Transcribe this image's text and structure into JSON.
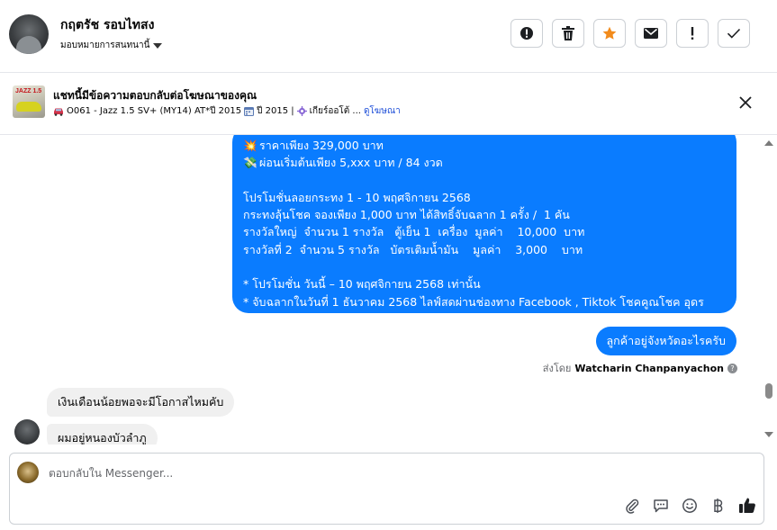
{
  "header": {
    "contact_name": "กฤตรัช รอบไทสง",
    "assign_label": "มอบหมายการสนทนานี้",
    "actions": [
      "alert-circle",
      "trash",
      "star",
      "envelope",
      "exclamation",
      "check"
    ],
    "star_color": "#f28b1c"
  },
  "banner": {
    "title": "แชทนี้มีข้อความตอบกลับต่อโฆษณาของคุณ",
    "car_text": "O061 - Jazz 1.5 SV+ (MY14) AT*ปี 2015",
    "year_text": "ปี 2015 |",
    "gear_text": "เกียร์ออโต้ ...",
    "link_text": "ดูโฆษณา",
    "thumb_text": "JAZZ 1.5"
  },
  "thread": {
    "promo_lines": [
      {
        "emoji": "💥",
        "text": "ราคาเพียง 329,000 บาท"
      },
      {
        "emoji": "💸",
        "text": "ผ่อนเริ่มต้นเพียง 5,xxx บาท / 84 งวด"
      },
      {
        "emoji": "",
        "text": ""
      },
      {
        "emoji": "",
        "text": "โปรโมชั่นลอยกระทง 1 - 10 พฤศจิกายน 2568"
      },
      {
        "emoji": "",
        "text": "กระทงลุ้นโชค จองเพียง 1,000 บาท ได้สิทธิ์จับฉลาก 1 ครั้ง /  1 คัน"
      },
      {
        "emoji": "",
        "text": "รางวัลใหญ่  จำนวน 1 รางวัล   ตู้เย็น 1  เครื่อง  มูลค่า    10,000  บาท"
      },
      {
        "emoji": "",
        "text": "รางวัลที่ 2  จำนวน 5 รางวัล   บัตรเติมน้ำมัน    มูลค่า    3,000    บาท"
      },
      {
        "emoji": "",
        "text": ""
      },
      {
        "emoji": "",
        "text": "* โปรโมชั่น วันนี้ – 10 พฤศจิกายน 2568 เท่านั้น"
      },
      {
        "emoji": "",
        "text": "* จับฉลากในวันที่ 1 ธันวาคม 2568 ไลฟ์สดผ่านช่องทาง Facebook , Tiktok โชคคูณโชค อุดร"
      }
    ],
    "reply_question": "ลูกค้าอยู่จังหวัดอะไรครับ",
    "sent_by_prefix": "ส่งโดย",
    "sent_by_name": "Watcharin Chanpanyachon",
    "customer_msg_1": "เงินเดือนน้อยพอจะมีโอกาสไหมคับ",
    "customer_msg_2": "ผมอยู่หนองบัวลำภู"
  },
  "compose": {
    "placeholder": "ตอบกลับใน Messenger...",
    "tools": [
      "paperclip",
      "chat-bubble",
      "smiley",
      "baht",
      "thumbs-up"
    ],
    "accent": "#0a7cff"
  }
}
